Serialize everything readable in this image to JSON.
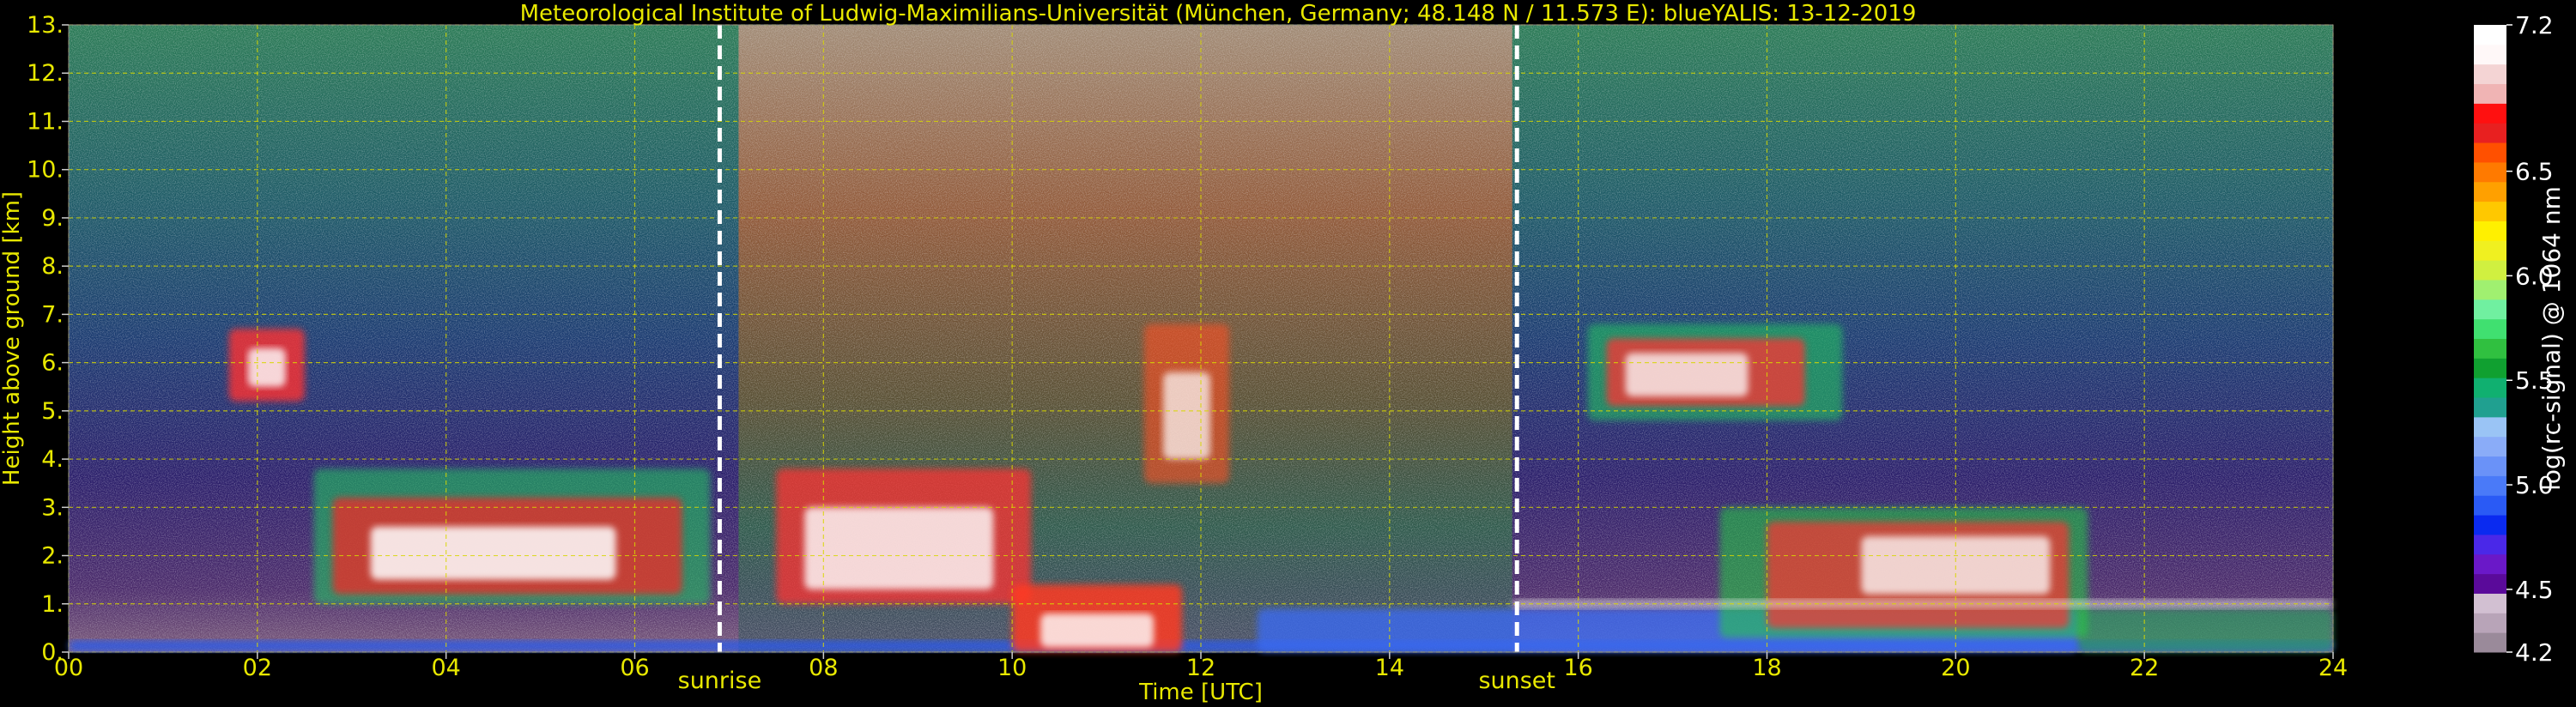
{
  "chart_data": {
    "type": "heatmap",
    "title": "Meteorological Institute of Ludwig-Maximilians-Universität (München, Germany; 48.148 N / 11.573 E):    blueYALIS: 13-12-2019",
    "xlabel": "Time [UTC]",
    "ylabel": "Height above ground [km]",
    "xlim": [
      0,
      24
    ],
    "ylim": [
      0,
      13
    ],
    "x_ticks": [
      "00",
      "02",
      "04",
      "06",
      "08",
      "10",
      "12",
      "14",
      "16",
      "18",
      "20",
      "22",
      "24"
    ],
    "y_ticks": [
      "0.",
      "1.",
      "2.",
      "3.",
      "4.",
      "5.",
      "6.",
      "7.",
      "8.",
      "9.",
      "10.",
      "11.",
      "12.",
      "13."
    ],
    "grid": true,
    "markers": [
      {
        "label": "sunrise",
        "x": 6.9
      },
      {
        "label": "sunset",
        "x": 15.35
      }
    ],
    "colorbar": {
      "label": "log(rc-signal) @ 1064 nm",
      "ticks": [
        "4.2",
        "4.5",
        "5.0",
        "5.5",
        "6.0",
        "6.5",
        "7.2"
      ],
      "tick_values": [
        4.2,
        4.5,
        5.0,
        5.5,
        6.0,
        6.5,
        7.2
      ],
      "range": [
        4.2,
        7.2
      ],
      "colors": [
        "#9a8a9a",
        "#b8a4b8",
        "#d2c0d2",
        "#5a0a9a",
        "#6a18c8",
        "#4a28e8",
        "#0a2af0",
        "#2a5af5",
        "#4a7af8",
        "#6a92f8",
        "#8aacf8",
        "#9ac4f5",
        "#20a090",
        "#10b070",
        "#10a030",
        "#30c040",
        "#40e070",
        "#70f0a0",
        "#a0f070",
        "#d0f040",
        "#f0f020",
        "#fff000",
        "#ffc800",
        "#ffa000",
        "#ff7a00",
        "#ff5000",
        "#e82020",
        "#ff1010",
        "#f0b4b4",
        "#f4d4d4",
        "#fff8f8",
        "#ffffff"
      ]
    },
    "features": [
      {
        "label": "sunrise",
        "x": 6.9
      },
      {
        "label": "sunset",
        "x": 15.35
      }
    ]
  }
}
